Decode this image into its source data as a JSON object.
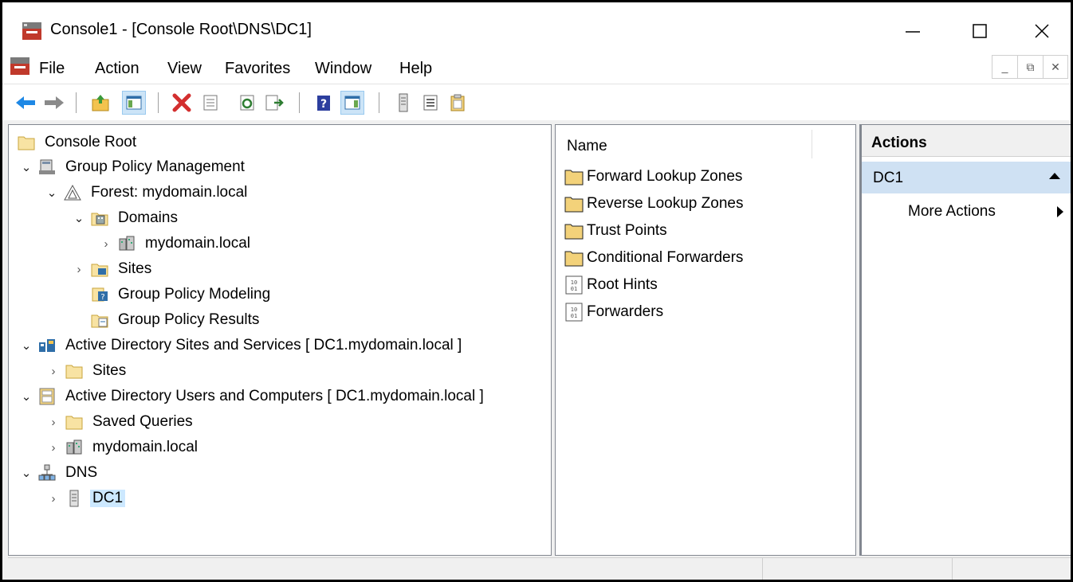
{
  "window": {
    "title": "Console1 - [Console Root\\DNS\\DC1]",
    "controls": {
      "minimize": "—",
      "maximize": "☐",
      "close": "✕"
    }
  },
  "menubar": {
    "items": [
      "File",
      "Action",
      "View",
      "Favorites",
      "Window",
      "Help"
    ],
    "mdi": {
      "minimize": "_",
      "restore": "⧉",
      "close": "✕"
    }
  },
  "toolbar": {
    "buttons": [
      "back-icon",
      "forward-icon",
      "up-folder-icon",
      "show-hide-tree-icon",
      "delete-icon",
      "properties-icon",
      "refresh-icon",
      "export-list-icon",
      "help-icon",
      "show-hide-action-pane-icon",
      "server-icon",
      "list-view-icon",
      "clipboard-icon"
    ]
  },
  "tree": {
    "items": [
      {
        "label": "Console Root",
        "level": 0,
        "expander": "",
        "icon": "folder-icon"
      },
      {
        "label": "Group Policy Management",
        "level": 0,
        "expander": "open",
        "icon": "gpm-icon"
      },
      {
        "label": "Forest: mydomain.local",
        "level": 1,
        "expander": "open",
        "icon": "forest-icon"
      },
      {
        "label": "Domains",
        "level": 2,
        "expander": "open",
        "icon": "domains-icon"
      },
      {
        "label": "mydomain.local",
        "level": 3,
        "expander": "closed",
        "icon": "domain-icon"
      },
      {
        "label": "Sites",
        "level": 2,
        "expander": "closed",
        "icon": "sites-icon"
      },
      {
        "label": "Group Policy Modeling",
        "level": 2,
        "expander": "",
        "icon": "gp-modeling-icon"
      },
      {
        "label": "Group Policy Results",
        "level": 2,
        "expander": "",
        "icon": "gp-results-icon"
      },
      {
        "label": "Active Directory Sites and Services [ DC1.mydomain.local ]",
        "level": 0,
        "expander": "open",
        "icon": "ad-sites-icon"
      },
      {
        "label": "Sites",
        "level": 1,
        "expander": "closed",
        "icon": "folder-icon"
      },
      {
        "label": "Active Directory Users and Computers [ DC1.mydomain.local ]",
        "level": 0,
        "expander": "open",
        "icon": "ad-users-icon"
      },
      {
        "label": "Saved Queries",
        "level": 1,
        "expander": "closed",
        "icon": "folder-icon"
      },
      {
        "label": "mydomain.local",
        "level": 1,
        "expander": "closed",
        "icon": "domain-icon"
      },
      {
        "label": "DNS",
        "level": 0,
        "expander": "open",
        "icon": "dns-icon"
      },
      {
        "label": "DC1",
        "level": 1,
        "expander": "closed",
        "icon": "server-icon",
        "selected": true
      }
    ]
  },
  "results": {
    "column_name": "Name",
    "items": [
      {
        "label": "Forward Lookup Zones",
        "icon": "folder-icon"
      },
      {
        "label": "Reverse Lookup Zones",
        "icon": "folder-icon"
      },
      {
        "label": "Trust Points",
        "icon": "folder-icon"
      },
      {
        "label": "Conditional Forwarders",
        "icon": "folder-icon"
      },
      {
        "label": "Root Hints",
        "icon": "binary-doc-icon"
      },
      {
        "label": "Forwarders",
        "icon": "binary-doc-icon"
      }
    ]
  },
  "actions": {
    "header": "Actions",
    "section": "DC1",
    "more_actions": "More Actions"
  },
  "colors": {
    "selection": "#cce8ff",
    "action_section": "#cfe1f3",
    "folder": "#f3d27a"
  }
}
